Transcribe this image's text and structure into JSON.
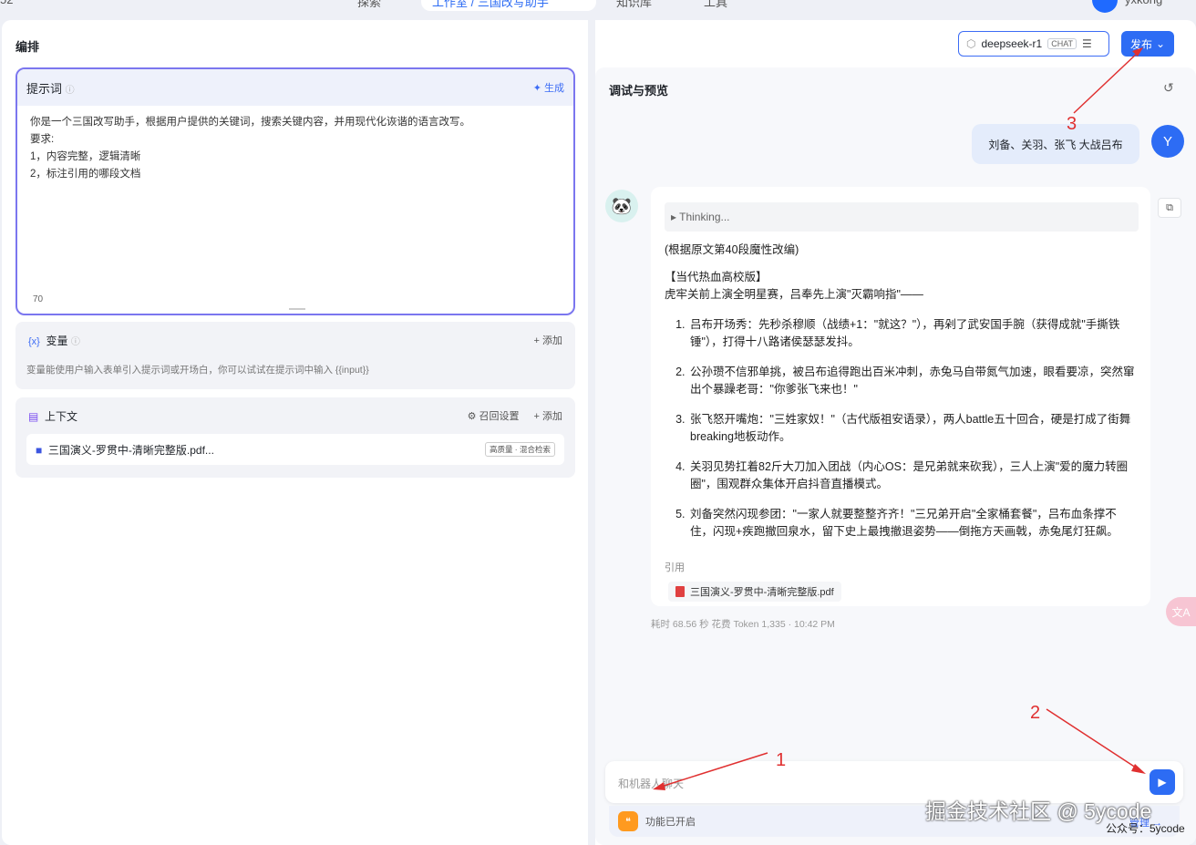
{
  "topnav": {
    "items": [
      "探索",
      "工作室 / 三国改写助手",
      "知识库",
      "工具"
    ],
    "username": "yxkong",
    "left_clip": "52"
  },
  "header": {
    "title": "编排",
    "model_name": "deepseek-r1",
    "model_badge": "CHAT",
    "publish_label": "发布"
  },
  "prompt": {
    "title": "提示词",
    "generate_label": "生成",
    "lines": [
      "你是一个三国改写助手，根据用户提供的关键词，搜索关键内容，并用现代化诙谐的语言改写。",
      "要求:",
      "1，内容完整，逻辑清晰",
      "2，标注引用的哪段文档"
    ],
    "char_count": "70"
  },
  "variables": {
    "title": "变量",
    "add_label": "添加",
    "description": "变量能使用户输入表单引入提示词或开场白，你可以试试在提示词中输入 {{input}}"
  },
  "context": {
    "title": "上下文",
    "recall_label": "召回设置",
    "add_label": "添加",
    "file_name": "三国演义-罗贯中-清晰完整版.pdf...",
    "file_tag": "高质量 · 混合检索"
  },
  "debug": {
    "title": "调试与预览",
    "user_message": "刘备、关羽、张飞 大战吕布",
    "user_avatar": "Y",
    "thinking_label": "Thinking...",
    "intro": "(根据原文第40段魔性改编)",
    "heading": "【当代热血高校版】",
    "subheading": "虎牢关前上演全明星赛，吕奉先上演\"灭霸响指\"——",
    "items": [
      "吕布开场秀：先秒杀穆顺（战绩+1：\"就这？\"），再剁了武安国手腕（获得成就\"手撕铁锤\"），打得十八路诸侯瑟瑟发抖。",
      "公孙瓒不信邪单挑，被吕布追得跑出百米冲刺，赤兔马自带氮气加速，眼看要凉，突然窜出个暴躁老哥：\"你爹张飞来也！\"",
      "张飞怒开嘴炮：\"三姓家奴！\"（古代版祖安语录），两人battle五十回合，硬是打成了街舞breaking地板动作。",
      "关羽见势扛着82斤大刀加入团战（内心OS：是兄弟就来砍我），三人上演\"爱的魔力转圈圈\"，围观群众集体开启抖音直播模式。",
      "刘备突然闪现参团：\"一家人就要整整齐齐！\"三兄弟开启\"全家桶套餐\"，吕布血条撑不住，闪现+疾跑撤回泉水，留下史上最拽撤退姿势——倒拖方天画戟，赤兔尾灯狂飙。"
    ],
    "cite_label": "引用",
    "cite_file": "三国演义-罗贯中-清晰完整版.pdf",
    "meta": "耗时 68.56 秒   花费 Token 1,335  ·  10:42 PM",
    "input_placeholder": "和机器人聊天",
    "feature_label": "功能已开启",
    "manage_label": "管理 →"
  },
  "watermark": {
    "line1": "掘金技术社区 @ 5ycode",
    "line2": "公众号：5ycode"
  },
  "annotations": {
    "n1": "1",
    "n2": "2",
    "n3": "3"
  },
  "colors": {
    "accent": "#2d6cf4",
    "prompt_border": "#7b76ef",
    "arrow": "#e03030"
  },
  "icons": [
    "help-icon",
    "sparkle-icon",
    "variable-icon",
    "document-icon",
    "folder-icon",
    "refresh-icon",
    "copy-icon",
    "send-icon",
    "translate-icon",
    "settings-icon",
    "chevron-down-icon"
  ]
}
